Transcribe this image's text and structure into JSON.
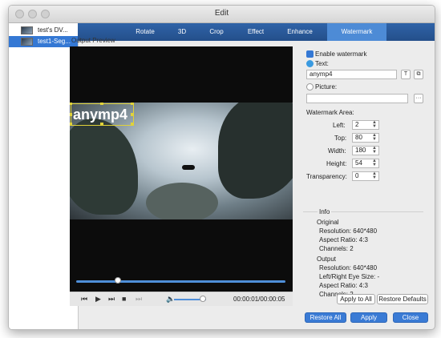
{
  "window": {
    "title": "Edit"
  },
  "files": [
    {
      "name": "test's DV..."
    },
    {
      "name": "test1-Seg..."
    }
  ],
  "tabs": [
    "Rotate",
    "3D",
    "Crop",
    "Effect",
    "Enhance",
    "Watermark"
  ],
  "active_tab": "Watermark",
  "preview": {
    "label": "Output Preview",
    "watermark_text": "anymp4",
    "time": "00:00:01/00:00:05",
    "seek_fraction": 0.2,
    "volume_fraction": 0.9
  },
  "watermark": {
    "enable_label": "Enable watermark",
    "enabled": true,
    "text_label": "Text:",
    "text_value": "anymp4",
    "font_button_icon": "T",
    "color_button_icon": "⧉",
    "picture_label": "Picture:",
    "picture_value": "",
    "browse_icon": "···",
    "area_label": "Watermark Area:",
    "left_label": "Left:",
    "left_value": "2",
    "top_label": "Top:",
    "top_value": "80",
    "width_label": "Width:",
    "width_value": "180",
    "height_label": "Height:",
    "height_value": "54",
    "transparency_label": "Transparency:",
    "transparency_value": "0"
  },
  "info": {
    "title": "Info",
    "original_label": "Original",
    "original_resolution": "Resolution: 640*480",
    "original_aspect": "Aspect Ratio: 4:3",
    "original_channels": "Channels: 2",
    "output_label": "Output",
    "output_resolution": "Resolution: 640*480",
    "output_eye": "Left/Right Eye Size: -",
    "output_aspect": "Aspect Ratio: 4:3",
    "output_channels": "Channels: 2"
  },
  "buttons": {
    "apply_to_all": "Apply to All",
    "restore_defaults": "Restore Defaults",
    "restore_all": "Restore All",
    "apply": "Apply",
    "close": "Close"
  },
  "colors": {
    "accent": "#3a7bd5",
    "tab_bar": "#2f63a8",
    "watermark_box": "#e0d23a"
  }
}
